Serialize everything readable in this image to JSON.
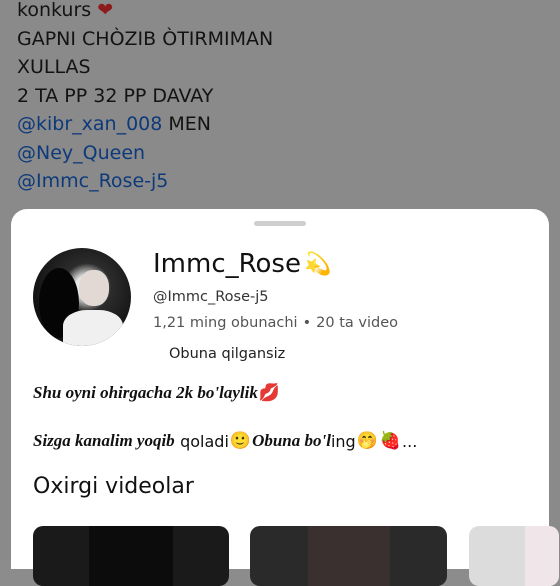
{
  "background_chat": {
    "lines": [
      {
        "text": "konkurs",
        "emoji": "❤"
      },
      {
        "text": "GAPNI CHÒZIB ÒTIRMIMAN"
      },
      {
        "text": "XULLAS"
      },
      {
        "text": "2 TA PP  32 PP DAVAY"
      },
      {
        "mention": "@kibr_xan_008",
        "text": " MEN"
      },
      {
        "mention": "@Ney_Queen"
      },
      {
        "mention": "@Immc_Rose-j5"
      }
    ]
  },
  "profile": {
    "name": "Immc_Rose",
    "name_emoji": "💫",
    "handle": "@Immc_Rose-j5",
    "subscribers": "1,21 ming obunachi",
    "separator": "•",
    "videos": "20 ta video",
    "subscribe_status": "Obuna qilgansiz"
  },
  "bio": {
    "line1_text": "Shu oyni ohirgacha 2k bo'laylik",
    "line1_emoji": "💋",
    "line2_part1": "Sizga kanalim yoqib",
    "line2_part2": "qoladi",
    "line2_emoji1": "🙂",
    "line2_part3": "Obuna bo'l",
    "line2_part4": "ing",
    "line2_emoji2": "🤭",
    "line2_emoji3": "🍓",
    "line2_ellipsis": "..."
  },
  "section": {
    "title": "Oxirgi videolar"
  },
  "colors": {
    "background_dim": "#8a8a8a",
    "mention": "#0d3a7a",
    "sheet": "#ffffff"
  }
}
